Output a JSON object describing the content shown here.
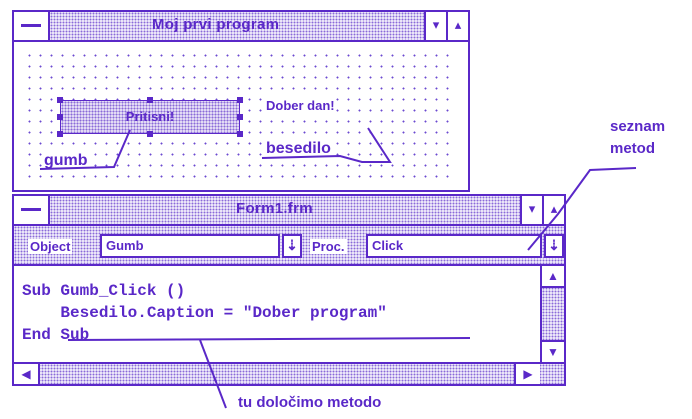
{
  "form_window": {
    "title": "Moj prvi program",
    "controls": {
      "button_caption": "Pritisni!",
      "label_caption": "Dober dan!"
    },
    "annotations": {
      "button_name": "gumb",
      "label_name": "besedilo"
    }
  },
  "code_window": {
    "title": "Form1.frm",
    "object_label": "Object",
    "object_value": "Gumb",
    "proc_label": "Proc.",
    "proc_value": "Click",
    "code_lines": [
      "Sub Gumb_Click ()",
      "    Besedilo.Caption = \"Dober program\"",
      "End Sub"
    ]
  },
  "callouts": {
    "method_list_line1": "seznam",
    "method_list_line2": "metod",
    "define_method": "tu določimo metodo"
  },
  "colors": {
    "ink": "#5a28c8",
    "background": "#ffffff"
  },
  "icons": {
    "system_menu": "dash-icon",
    "minimize": "arrow-down-icon",
    "maximize": "arrow-up-icon",
    "combo_dropdown": "arrow-down-icon",
    "scroll_up": "arrow-up-icon",
    "scroll_down": "arrow-down-icon",
    "scroll_left": "arrow-left-icon",
    "scroll_right": "arrow-right-icon"
  }
}
